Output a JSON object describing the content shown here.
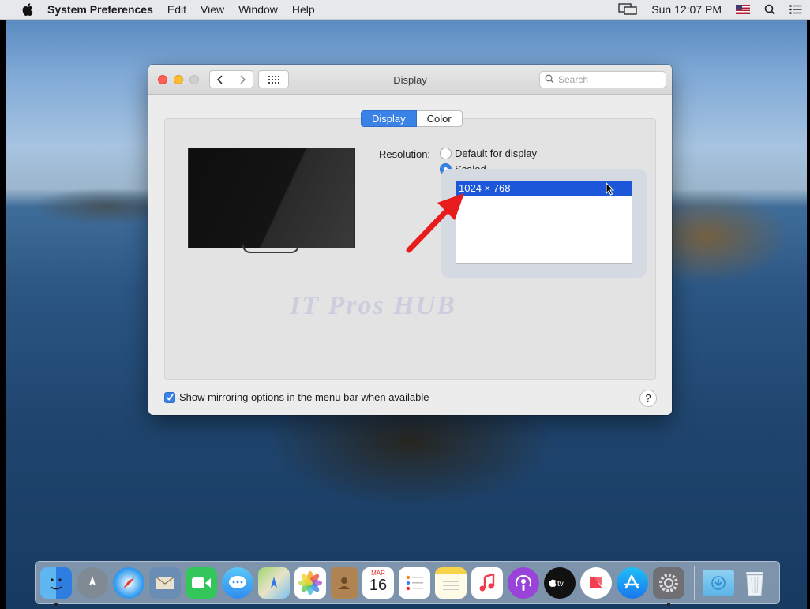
{
  "menubar": {
    "app_name": "System Preferences",
    "menus": [
      "Edit",
      "View",
      "Window",
      "Help"
    ],
    "clock": "Sun 12:07 PM"
  },
  "window": {
    "title": "Display",
    "search_placeholder": "Search",
    "tabs": [
      {
        "label": "Display",
        "active": true
      },
      {
        "label": "Color",
        "active": false
      }
    ],
    "resolution_label": "Resolution:",
    "resolution_options": [
      {
        "label": "Default for display",
        "selected": false
      },
      {
        "label": "Scaled",
        "selected": true
      }
    ],
    "scaled_list": [
      "1024 × 768"
    ],
    "selected_resolution": "1024 × 768",
    "watermark": "IT Pros HUB",
    "mirroring_checkbox": {
      "label": "Show mirroring options in the menu bar when available",
      "checked": true
    },
    "help": "?"
  },
  "dock": {
    "calendar_month": "MAR",
    "calendar_day": "16",
    "apps": [
      "finder-icon",
      "launchpad-icon",
      "safari-icon",
      "mail-icon",
      "facetime-icon",
      "messages-icon",
      "maps-icon",
      "photos-icon",
      "contacts-icon",
      "calendar-icon",
      "reminders-icon",
      "notes-icon",
      "music-icon",
      "podcasts-icon",
      "tv-icon",
      "news-icon",
      "app-store-icon",
      "system-preferences-icon",
      "downloads-folder-icon",
      "trash-icon"
    ]
  },
  "colors": {
    "accent": "#3b82e6",
    "selection": "#1b57d8",
    "annotation_arrow": "#e81c1c"
  }
}
